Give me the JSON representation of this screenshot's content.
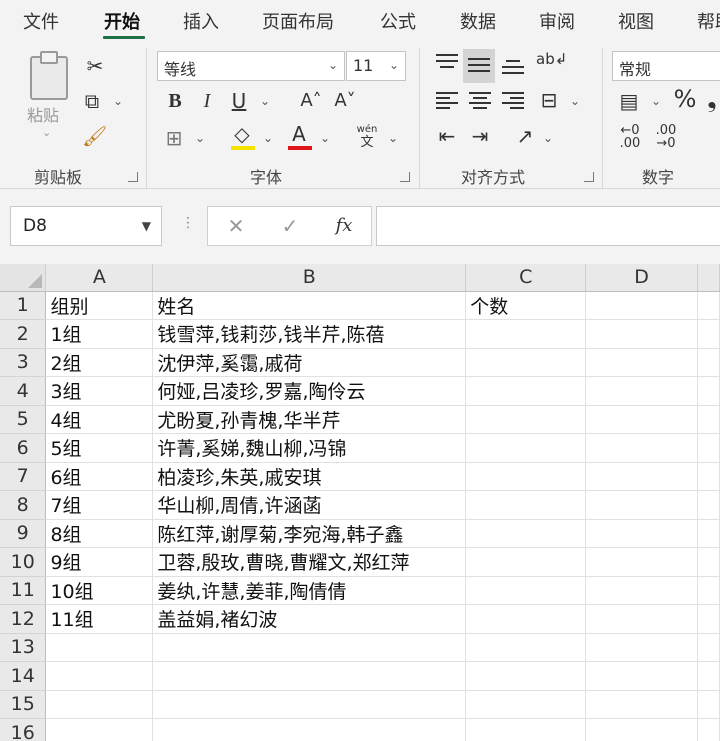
{
  "ribbon_tabs": [
    "文件",
    "开始",
    "插入",
    "页面布局",
    "公式",
    "数据",
    "审阅",
    "视图",
    "帮助"
  ],
  "active_tab": "开始",
  "ribbon": {
    "clipboard": {
      "paste_label": "粘贴",
      "group_label": "剪贴板"
    },
    "font": {
      "font_name": "等线",
      "font_size": "11",
      "group_label": "字体",
      "wen_top": "wén",
      "wen_bottom": "文"
    },
    "alignment": {
      "group_label": "对齐方式"
    },
    "number": {
      "format": "常规",
      "percent": "%",
      "group_label": "数字"
    }
  },
  "formula_bar": {
    "name_box": "D8",
    "fx": "fx",
    "content": ""
  },
  "grid": {
    "columns": [
      "A",
      "B",
      "C",
      "D"
    ],
    "rows": [
      {
        "num": "1",
        "a": "组别",
        "b": "姓名",
        "c": "个数",
        "d": ""
      },
      {
        "num": "2",
        "a": "1组",
        "b": "钱雪萍,钱莉莎,钱半芹,陈蓓",
        "c": "",
        "d": ""
      },
      {
        "num": "3",
        "a": "2组",
        "b": "沈伊萍,奚霭,戚荷",
        "c": "",
        "d": ""
      },
      {
        "num": "4",
        "a": "3组",
        "b": "何娅,吕凌珍,罗嘉,陶伶云",
        "c": "",
        "d": ""
      },
      {
        "num": "5",
        "a": "4组",
        "b": "尤盼夏,孙青槐,华半芹",
        "c": "",
        "d": ""
      },
      {
        "num": "6",
        "a": "5组",
        "b": "许菁,奚娣,魏山柳,冯锦",
        "c": "",
        "d": ""
      },
      {
        "num": "7",
        "a": "6组",
        "b": "柏凌珍,朱英,戚安琪",
        "c": "",
        "d": ""
      },
      {
        "num": "8",
        "a": "7组",
        "b": "华山柳,周倩,许涵菡",
        "c": "",
        "d": ""
      },
      {
        "num": "9",
        "a": "8组",
        "b": "陈红萍,谢厚菊,李宛海,韩子鑫",
        "c": "",
        "d": ""
      },
      {
        "num": "10",
        "a": "9组",
        "b": "卫蓉,殷玫,曹晓,曹耀文,郑红萍",
        "c": "",
        "d": ""
      },
      {
        "num": "11",
        "a": "10组",
        "b": "姜纨,许慧,姜菲,陶倩倩",
        "c": "",
        "d": ""
      },
      {
        "num": "12",
        "a": "11组",
        "b": "盖益娟,褚幻波",
        "c": "",
        "d": ""
      },
      {
        "num": "13",
        "a": "",
        "b": "",
        "c": "",
        "d": ""
      },
      {
        "num": "14",
        "a": "",
        "b": "",
        "c": "",
        "d": ""
      },
      {
        "num": "15",
        "a": "",
        "b": "",
        "c": "",
        "d": ""
      },
      {
        "num": "16",
        "a": "",
        "b": "",
        "c": "",
        "d": ""
      }
    ]
  },
  "colors": {
    "accent": "#1e7145",
    "highlight_yellow": "#f5e400",
    "font_red": "#e0161b"
  }
}
